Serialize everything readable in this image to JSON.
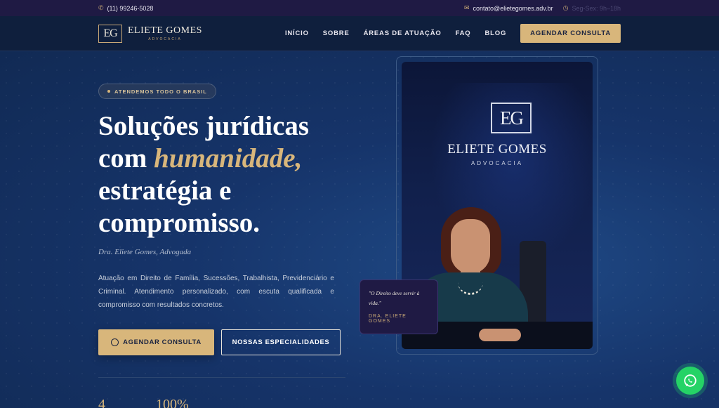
{
  "topbar": {
    "phone": "(11) 99246-5028",
    "email": "contato@elietegomes.adv.br",
    "hours": "Seg-Sex: 9h–18h"
  },
  "nav": {
    "logo_mark": "EG",
    "logo_name": "ELIETE GOMES",
    "logo_sub": "ADVOCACIA",
    "links": [
      "INÍCIO",
      "SOBRE",
      "ÁREAS DE ATUAÇÃO",
      "FAQ",
      "BLOG"
    ],
    "cta": "AGENDAR CONSULTA"
  },
  "hero": {
    "badge": "ATENDEMOS TODO O BRASIL",
    "headline_1": "Soluções jurídicas",
    "headline_2a": "com ",
    "headline_2b": "humanidade,",
    "headline_3": "estratégia e",
    "headline_4": "compromisso.",
    "signature": "Dra. Eliete Gomes, Advogada",
    "description": "Atuação em Direito de Família, Sucessões, Trabalhista, Previdenciário e Criminal. Atendimento personalizado, com escuta qualificada e compromisso com resultados concretos.",
    "btn_primary": "AGENDAR CONSULTA",
    "btn_secondary": "NOSSAS ESPECIALIDADES",
    "stat_1": "4",
    "stat_2": "100%"
  },
  "photo": {
    "logo_mark": "EG",
    "logo_name": "ELIETE GOMES",
    "logo_sub": "ADVOCACIA"
  },
  "quote": {
    "text": "\"O Direito deve servir à vida.\"",
    "author": "DRA. ELIETE GOMES"
  },
  "colors": {
    "gold": "#d8b67b",
    "navy": "#0f1f3d",
    "topbar": "#1f1a44",
    "whatsapp": "#25d366"
  }
}
